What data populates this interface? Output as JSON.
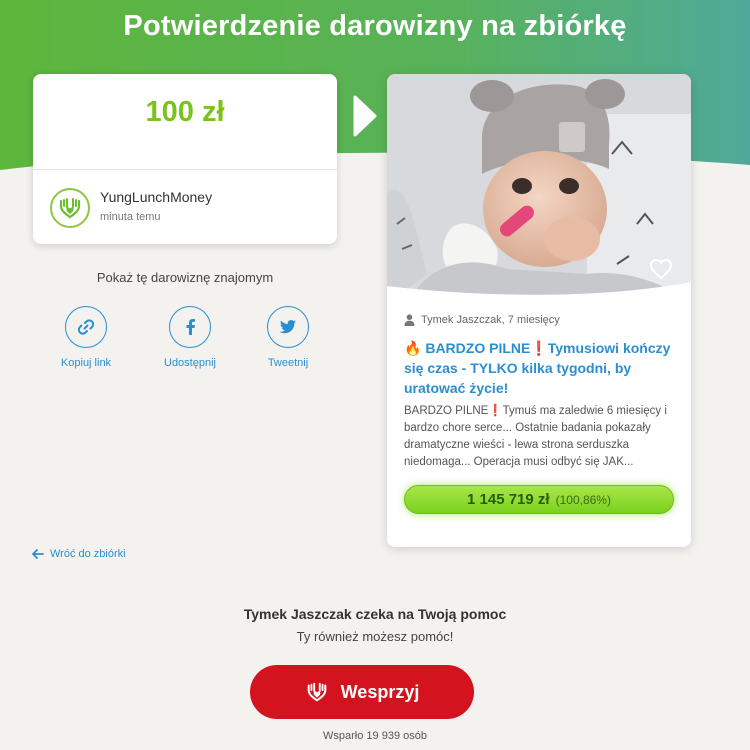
{
  "page": {
    "title": "Potwierdzenie darowizny na zbiórkę"
  },
  "donation": {
    "amount": "100 zł",
    "donor_name": "YungLunchMoney",
    "time": "minuta temu"
  },
  "share": {
    "title": "Pokaż tę darowiznę znajomym",
    "copy_label": "Kopiuj link",
    "facebook_label": "Udostępnij",
    "twitter_label": "Tweetnij"
  },
  "back_link": "Wróć do zbiórki",
  "fundraiser": {
    "author": "Tymek Jaszczak, 7 miesięcy",
    "title_emoji": "🔥",
    "title": "BARDZO PILNE❗Tymusiowi kończy się czas - TYLKO kilka tygodni, by uratować życie!",
    "description": "BARDZO PILNE❗Tymuś ma zaledwie 6 miesięcy i bardzo chore serce... Ostatnie badania pokazały dramatyczne wieści - lewa strona serduszka niedomaga... Operacja musi odbyć się JAK...",
    "raised": "1 145 719 zł",
    "percent": "(100,86%)"
  },
  "cta": {
    "waits": "Tymek Jaszczak czeka na Twoją pomoc",
    "you_too": "Ty również możesz pomóc!",
    "button": "Wesprzyj",
    "supporters": "Wsparło 19 939 osób"
  },
  "colors": {
    "header_green_left": "#5cb83a",
    "header_green_right": "#4fa99a",
    "amount_green": "#7cc21d",
    "link_blue": "#2a8fd0",
    "cta_red": "#d3141e"
  },
  "icons": {
    "donor": "helping-hands-heart-icon",
    "next": "triangle-right-icon",
    "copy": "link-icon",
    "facebook": "facebook-icon",
    "twitter": "twitter-icon",
    "back": "arrow-left-icon",
    "heart": "heart-outline-icon",
    "person": "person-icon",
    "fire": "fire-icon",
    "cta": "helping-hands-heart-icon"
  }
}
